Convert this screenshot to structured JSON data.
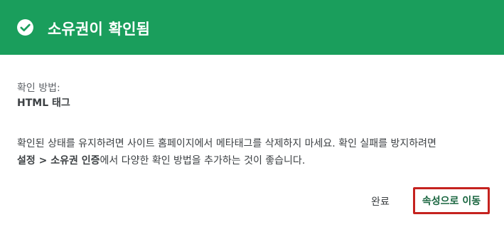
{
  "header": {
    "title": "소유권이 확인됨",
    "icon": "check-circle-icon",
    "background_color": "#1a9e5c"
  },
  "verification": {
    "method_label": "확인 방법:",
    "method_value": "HTML 태그"
  },
  "description": {
    "line1": "확인된 상태를 유지하려면 사이트 홈페이지에서 메타태그를 삭제하지 마세요. 확인 실패를 방지하려면",
    "line2_bold": "설정 > 소유권 인증",
    "line2_rest": "에서 다양한 확인 방법을 추가하는 것이 좋습니다."
  },
  "actions": {
    "done_label": "완료",
    "go_to_property_label": "속성으로 이동",
    "highlight_color": "#c5221f"
  }
}
